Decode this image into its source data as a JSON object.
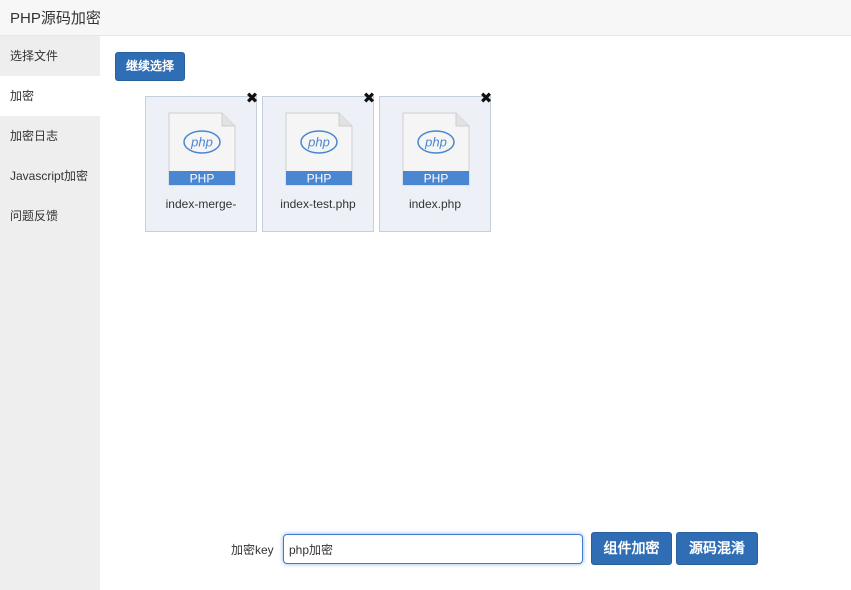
{
  "app": {
    "title": "PHP源码加密"
  },
  "sidebar": {
    "items": [
      {
        "label": "选择文件"
      },
      {
        "label": "加密"
      },
      {
        "label": "加密日志"
      },
      {
        "label": "Javascript加密"
      },
      {
        "label": "问题反馈"
      }
    ],
    "active_index": 1
  },
  "toolbar": {
    "continue_label": "继续选择"
  },
  "files": [
    {
      "name": "index-merge-",
      "type_label": "PHP",
      "logo_text": "php"
    },
    {
      "name": "index-test.php",
      "type_label": "PHP",
      "logo_text": "php"
    },
    {
      "name": "index.php",
      "type_label": "PHP",
      "logo_text": "php"
    }
  ],
  "form": {
    "key_label": "加密key",
    "key_value": "php加密",
    "encrypt_button": "组件加密",
    "obfuscate_button": "源码混淆"
  },
  "colors": {
    "primary_button": "#2f6eb5",
    "file_card_bg": "#edf1f7",
    "php_band": "#4a86d1"
  },
  "icons": {
    "remove": "close-icon",
    "file": "php-file-icon"
  }
}
